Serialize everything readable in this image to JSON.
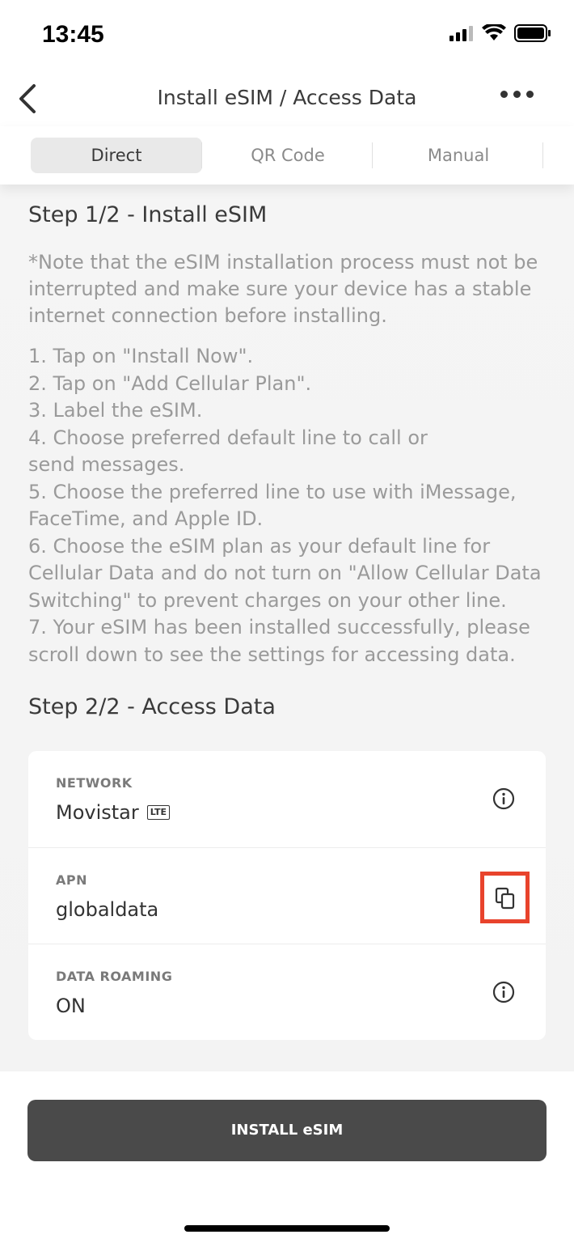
{
  "status_bar": {
    "time": "13:45"
  },
  "header": {
    "title": "Install eSIM / Access Data"
  },
  "tabs": [
    {
      "label": "Direct",
      "active": true
    },
    {
      "label": "QR Code",
      "active": false
    },
    {
      "label": "Manual",
      "active": false
    }
  ],
  "step1": {
    "title": "Step 1/2 - Install eSIM",
    "note": "*Note that the eSIM installation process must not be interrupted and make sure your device has a stable internet connection before installing.",
    "items": [
      "1. Tap on \"Install Now\".",
      "2. Tap on \"Add Cellular Plan\".",
      "3. Label the eSIM.",
      "4. Choose preferred default line to call or\nsend messages.",
      "5. Choose the preferred line to use with iMessage, FaceTime, and Apple ID.",
      "6. Choose the eSIM plan as your default line for Cellular Data and do not turn on \"Allow Cellular Data Switching\" to prevent charges on your other line.",
      "7. Your eSIM has been installed successfully, please scroll down to see the settings for accessing data."
    ]
  },
  "step2": {
    "title": "Step 2/2 - Access Data",
    "network": {
      "label": "NETWORK",
      "value": "Movistar",
      "badge": "LTE"
    },
    "apn": {
      "label": "APN",
      "value": "globaldata"
    },
    "roaming": {
      "label": "DATA ROAMING",
      "value": "ON"
    }
  },
  "install_button": {
    "label": "INSTALL eSIM"
  },
  "colors": {
    "highlight": "#e8432c",
    "button": "#4a4a4a"
  }
}
